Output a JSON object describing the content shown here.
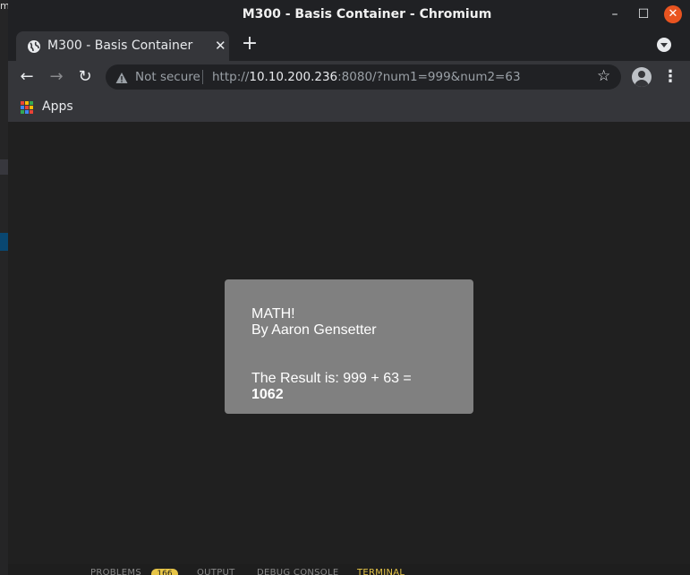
{
  "window": {
    "title": "M300 - Basis Container - Chromium",
    "controls": {
      "minimize": "–",
      "maximize": "☐",
      "close": "✕"
    }
  },
  "tabs": [
    {
      "title": "M300 - Basis Container",
      "close": "✕"
    }
  ],
  "newtab_label": "+",
  "toolbar": {
    "back": "←",
    "forward": "→",
    "reload": "↻",
    "security_label": "Not secure",
    "url_scheme": "http://",
    "url_host": "10.10.200.236",
    "url_rest": ":8080/?num1=999&num2=63",
    "star": "☆",
    "menu": "⋮"
  },
  "bookmarks": {
    "apps_label": "Apps",
    "apps_colors": [
      "#ea4335",
      "#fbbc05",
      "#34a853",
      "#4285f4",
      "#ea4335",
      "#fbbc05",
      "#34a853",
      "#4285f4",
      "#ea4335"
    ]
  },
  "page": {
    "heading": "MATH!",
    "author": "By Aaron Gensetter",
    "result_prefix": "The Result is: 999 + 63 = ",
    "result_value": "1062",
    "card_color": "#808080",
    "background_color": "#202020"
  },
  "background_window": {
    "left_text": "m",
    "panel_tabs": [
      "PROBLEMS",
      "OUTPUT",
      "DEBUG CONSOLE",
      "TERMINAL"
    ],
    "problems_count": "166"
  },
  "colors": {
    "close_button": "#e95420",
    "terminal_accent": "#e7c547"
  }
}
